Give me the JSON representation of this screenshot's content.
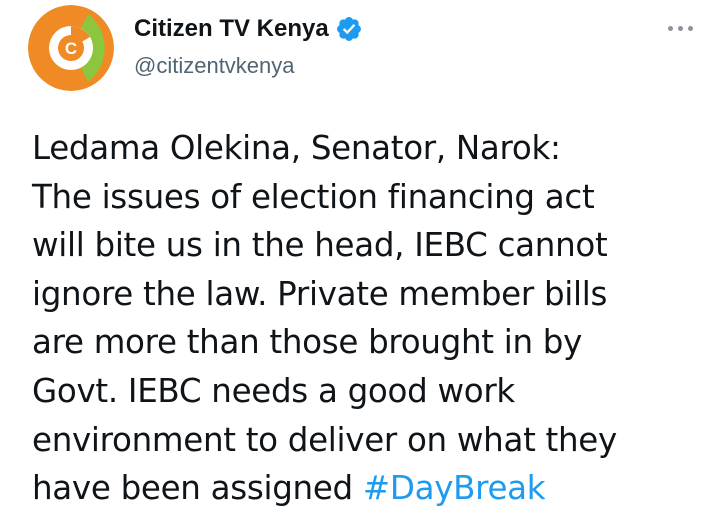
{
  "author": {
    "display_name": "Citizen TV Kenya",
    "handle": "@citizentvkenya",
    "verified": true,
    "avatar_icon": "citizen-tv-logo-icon"
  },
  "menu": {
    "icon": "more-options-icon"
  },
  "tweet": {
    "lines": [
      "Ledama Olekina, Senator, Narok:",
      "The issues of election financing act",
      "will bite us in the head, IEBC cannot",
      "ignore the law. Private member bills",
      "are more than those brought in by",
      "Govt. IEBC needs a good work",
      "environment to deliver on what they"
    ],
    "last_line_text": "have been assigned ",
    "hashtag": "#DayBreak"
  },
  "colors": {
    "hashtag": "#1d9bf0",
    "verified_badge": "#1d9bf0",
    "handle": "#536471",
    "logo_orange": "#f08a24",
    "logo_green": "#8cc63f"
  }
}
